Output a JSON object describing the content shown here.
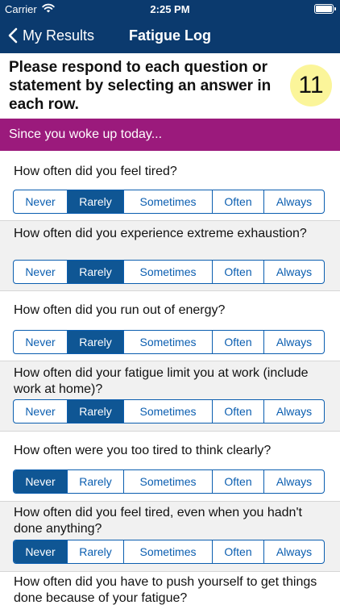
{
  "status_bar": {
    "carrier": "Carrier",
    "time": "2:25 PM"
  },
  "nav": {
    "back_label": "My Results",
    "title": "Fatigue Log"
  },
  "instructions": {
    "text": "Please respond to each question or statement by selecting an answer in each row.",
    "page_number": "11"
  },
  "section": {
    "header": "Since you woke up today..."
  },
  "options": [
    "Never",
    "Rarely",
    "Sometimes",
    "Often",
    "Always"
  ],
  "questions": [
    {
      "text": "How often did you feel tired?",
      "selected": "Rarely"
    },
    {
      "text": "How often did you experience extreme exhaustion?",
      "selected": "Rarely"
    },
    {
      "text": "How often did you run out of energy?",
      "selected": "Rarely"
    },
    {
      "text": "How often did your fatigue limit you at work (include work at home)?",
      "selected": "Rarely"
    },
    {
      "text": "How often were you too tired to think clearly?",
      "selected": "Never"
    },
    {
      "text": "How often did you feel tired, even when you hadn't done anything?",
      "selected": "Never"
    },
    {
      "text": "How often did you have to push yourself to get things done because of your fatigue?",
      "selected": null
    }
  ],
  "colors": {
    "nav_background": "#0b3a6e",
    "section_header": "#9b1a7c",
    "segment_accent": "#0b5eb0",
    "segment_selected": "#0f5694",
    "page_badge": "#fbf59a"
  }
}
